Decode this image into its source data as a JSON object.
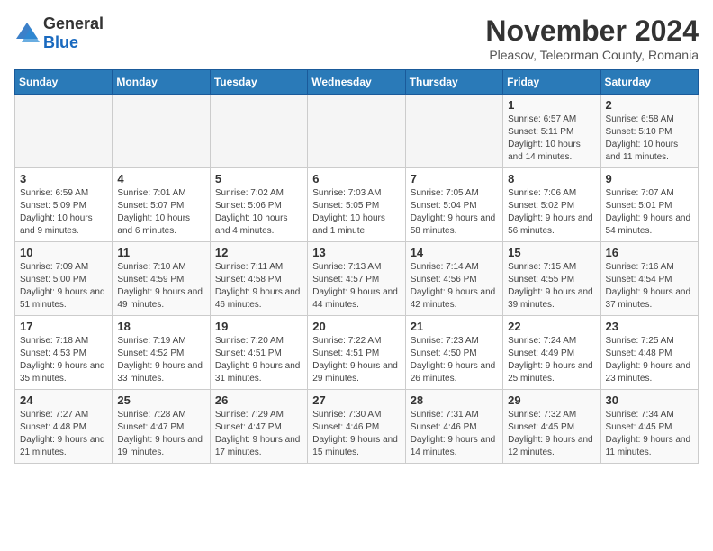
{
  "logo": {
    "general": "General",
    "blue": "Blue"
  },
  "title": "November 2024",
  "subtitle": "Pleasov, Teleorman County, Romania",
  "days_of_week": [
    "Sunday",
    "Monday",
    "Tuesday",
    "Wednesday",
    "Thursday",
    "Friday",
    "Saturday"
  ],
  "weeks": [
    [
      {
        "day": "",
        "sunrise": "",
        "sunset": "",
        "daylight": ""
      },
      {
        "day": "",
        "sunrise": "",
        "sunset": "",
        "daylight": ""
      },
      {
        "day": "",
        "sunrise": "",
        "sunset": "",
        "daylight": ""
      },
      {
        "day": "",
        "sunrise": "",
        "sunset": "",
        "daylight": ""
      },
      {
        "day": "",
        "sunrise": "",
        "sunset": "",
        "daylight": ""
      },
      {
        "day": "1",
        "sunrise": "Sunrise: 6:57 AM",
        "sunset": "Sunset: 5:11 PM",
        "daylight": "Daylight: 10 hours and 14 minutes."
      },
      {
        "day": "2",
        "sunrise": "Sunrise: 6:58 AM",
        "sunset": "Sunset: 5:10 PM",
        "daylight": "Daylight: 10 hours and 11 minutes."
      }
    ],
    [
      {
        "day": "3",
        "sunrise": "Sunrise: 6:59 AM",
        "sunset": "Sunset: 5:09 PM",
        "daylight": "Daylight: 10 hours and 9 minutes."
      },
      {
        "day": "4",
        "sunrise": "Sunrise: 7:01 AM",
        "sunset": "Sunset: 5:07 PM",
        "daylight": "Daylight: 10 hours and 6 minutes."
      },
      {
        "day": "5",
        "sunrise": "Sunrise: 7:02 AM",
        "sunset": "Sunset: 5:06 PM",
        "daylight": "Daylight: 10 hours and 4 minutes."
      },
      {
        "day": "6",
        "sunrise": "Sunrise: 7:03 AM",
        "sunset": "Sunset: 5:05 PM",
        "daylight": "Daylight: 10 hours and 1 minute."
      },
      {
        "day": "7",
        "sunrise": "Sunrise: 7:05 AM",
        "sunset": "Sunset: 5:04 PM",
        "daylight": "Daylight: 9 hours and 58 minutes."
      },
      {
        "day": "8",
        "sunrise": "Sunrise: 7:06 AM",
        "sunset": "Sunset: 5:02 PM",
        "daylight": "Daylight: 9 hours and 56 minutes."
      },
      {
        "day": "9",
        "sunrise": "Sunrise: 7:07 AM",
        "sunset": "Sunset: 5:01 PM",
        "daylight": "Daylight: 9 hours and 54 minutes."
      }
    ],
    [
      {
        "day": "10",
        "sunrise": "Sunrise: 7:09 AM",
        "sunset": "Sunset: 5:00 PM",
        "daylight": "Daylight: 9 hours and 51 minutes."
      },
      {
        "day": "11",
        "sunrise": "Sunrise: 7:10 AM",
        "sunset": "Sunset: 4:59 PM",
        "daylight": "Daylight: 9 hours and 49 minutes."
      },
      {
        "day": "12",
        "sunrise": "Sunrise: 7:11 AM",
        "sunset": "Sunset: 4:58 PM",
        "daylight": "Daylight: 9 hours and 46 minutes."
      },
      {
        "day": "13",
        "sunrise": "Sunrise: 7:13 AM",
        "sunset": "Sunset: 4:57 PM",
        "daylight": "Daylight: 9 hours and 44 minutes."
      },
      {
        "day": "14",
        "sunrise": "Sunrise: 7:14 AM",
        "sunset": "Sunset: 4:56 PM",
        "daylight": "Daylight: 9 hours and 42 minutes."
      },
      {
        "day": "15",
        "sunrise": "Sunrise: 7:15 AM",
        "sunset": "Sunset: 4:55 PM",
        "daylight": "Daylight: 9 hours and 39 minutes."
      },
      {
        "day": "16",
        "sunrise": "Sunrise: 7:16 AM",
        "sunset": "Sunset: 4:54 PM",
        "daylight": "Daylight: 9 hours and 37 minutes."
      }
    ],
    [
      {
        "day": "17",
        "sunrise": "Sunrise: 7:18 AM",
        "sunset": "Sunset: 4:53 PM",
        "daylight": "Daylight: 9 hours and 35 minutes."
      },
      {
        "day": "18",
        "sunrise": "Sunrise: 7:19 AM",
        "sunset": "Sunset: 4:52 PM",
        "daylight": "Daylight: 9 hours and 33 minutes."
      },
      {
        "day": "19",
        "sunrise": "Sunrise: 7:20 AM",
        "sunset": "Sunset: 4:51 PM",
        "daylight": "Daylight: 9 hours and 31 minutes."
      },
      {
        "day": "20",
        "sunrise": "Sunrise: 7:22 AM",
        "sunset": "Sunset: 4:51 PM",
        "daylight": "Daylight: 9 hours and 29 minutes."
      },
      {
        "day": "21",
        "sunrise": "Sunrise: 7:23 AM",
        "sunset": "Sunset: 4:50 PM",
        "daylight": "Daylight: 9 hours and 26 minutes."
      },
      {
        "day": "22",
        "sunrise": "Sunrise: 7:24 AM",
        "sunset": "Sunset: 4:49 PM",
        "daylight": "Daylight: 9 hours and 25 minutes."
      },
      {
        "day": "23",
        "sunrise": "Sunrise: 7:25 AM",
        "sunset": "Sunset: 4:48 PM",
        "daylight": "Daylight: 9 hours and 23 minutes."
      }
    ],
    [
      {
        "day": "24",
        "sunrise": "Sunrise: 7:27 AM",
        "sunset": "Sunset: 4:48 PM",
        "daylight": "Daylight: 9 hours and 21 minutes."
      },
      {
        "day": "25",
        "sunrise": "Sunrise: 7:28 AM",
        "sunset": "Sunset: 4:47 PM",
        "daylight": "Daylight: 9 hours and 19 minutes."
      },
      {
        "day": "26",
        "sunrise": "Sunrise: 7:29 AM",
        "sunset": "Sunset: 4:47 PM",
        "daylight": "Daylight: 9 hours and 17 minutes."
      },
      {
        "day": "27",
        "sunrise": "Sunrise: 7:30 AM",
        "sunset": "Sunset: 4:46 PM",
        "daylight": "Daylight: 9 hours and 15 minutes."
      },
      {
        "day": "28",
        "sunrise": "Sunrise: 7:31 AM",
        "sunset": "Sunset: 4:46 PM",
        "daylight": "Daylight: 9 hours and 14 minutes."
      },
      {
        "day": "29",
        "sunrise": "Sunrise: 7:32 AM",
        "sunset": "Sunset: 4:45 PM",
        "daylight": "Daylight: 9 hours and 12 minutes."
      },
      {
        "day": "30",
        "sunrise": "Sunrise: 7:34 AM",
        "sunset": "Sunset: 4:45 PM",
        "daylight": "Daylight: 9 hours and 11 minutes."
      }
    ]
  ]
}
